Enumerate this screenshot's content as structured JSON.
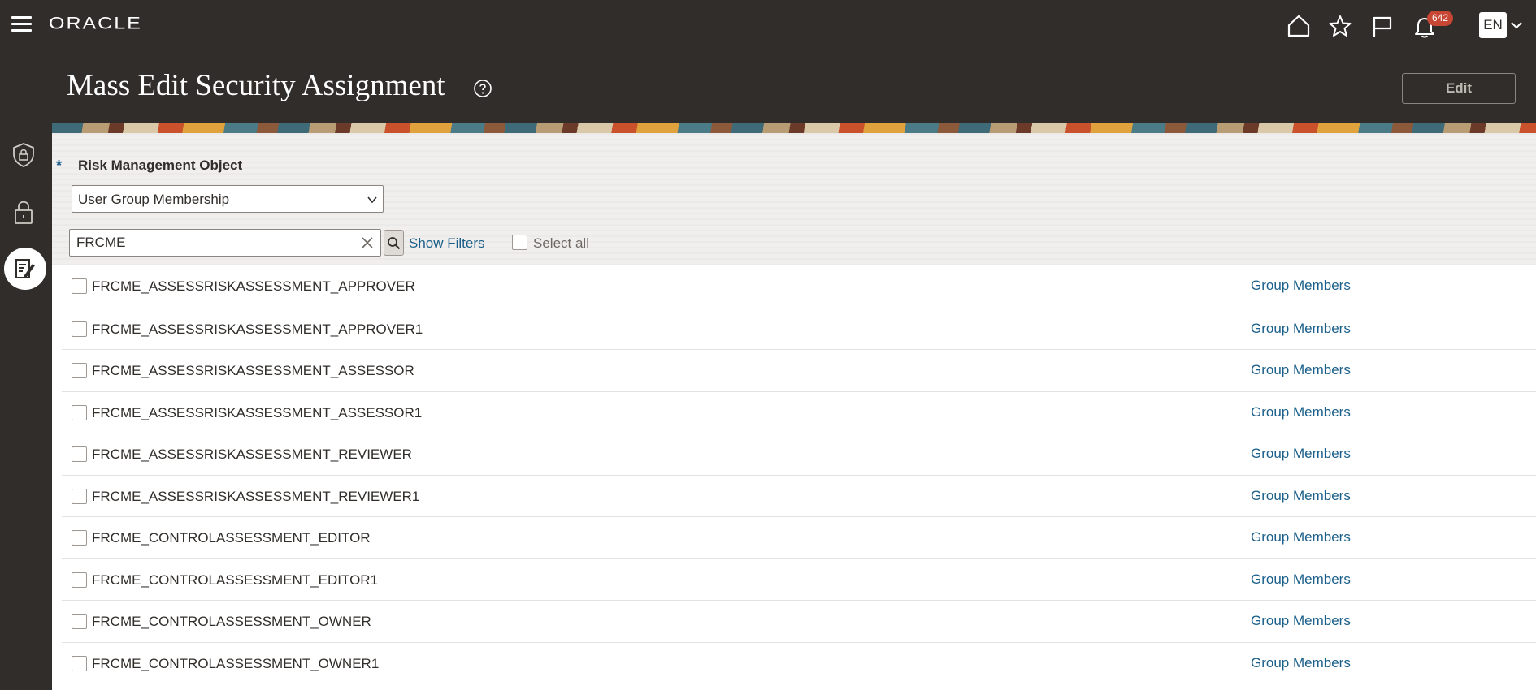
{
  "header": {
    "logo": "ORACLE",
    "notification_count": "642",
    "language": "EN"
  },
  "page": {
    "title": "Mass Edit Security Assignment",
    "edit_label": "Edit"
  },
  "filters": {
    "required_marker": "*",
    "field_label": "Risk Management Object",
    "select_value": "User Group Membership",
    "search_value": "FRCME",
    "show_filters_label": "Show Filters",
    "select_all_label": "Select all"
  },
  "rows": [
    {
      "name": "FRCME_ASSESSRISKASSESSMENT_APPROVER",
      "link": "Group Members"
    },
    {
      "name": "FRCME_ASSESSRISKASSESSMENT_APPROVER1",
      "link": "Group Members"
    },
    {
      "name": "FRCME_ASSESSRISKASSESSMENT_ASSESSOR",
      "link": "Group Members"
    },
    {
      "name": "FRCME_ASSESSRISKASSESSMENT_ASSESSOR1",
      "link": "Group Members"
    },
    {
      "name": "FRCME_ASSESSRISKASSESSMENT_REVIEWER",
      "link": "Group Members"
    },
    {
      "name": "FRCME_ASSESSRISKASSESSMENT_REVIEWER1",
      "link": "Group Members"
    },
    {
      "name": "FRCME_CONTROLASSESSMENT_EDITOR",
      "link": "Group Members"
    },
    {
      "name": "FRCME_CONTROLASSESSMENT_EDITOR1",
      "link": "Group Members"
    },
    {
      "name": "FRCME_CONTROLASSESSMENT_OWNER",
      "link": "Group Members"
    },
    {
      "name": "FRCME_CONTROLASSESSMENT_OWNER1",
      "link": "Group Members"
    }
  ],
  "icons": {
    "menu": "hamburger-menu-icon",
    "home": "home-icon",
    "favorites": "star-icon",
    "watchlist": "flag-icon",
    "notifications": "bell-icon",
    "help": "help-circle-icon",
    "nav_security": "shield-lock-icon",
    "nav_lock": "lock-icon",
    "nav_mass_edit": "edit-document-icon"
  },
  "colors": {
    "header_bg": "#312d2a",
    "link": "#1a5f8a",
    "badge": "#c74634"
  }
}
